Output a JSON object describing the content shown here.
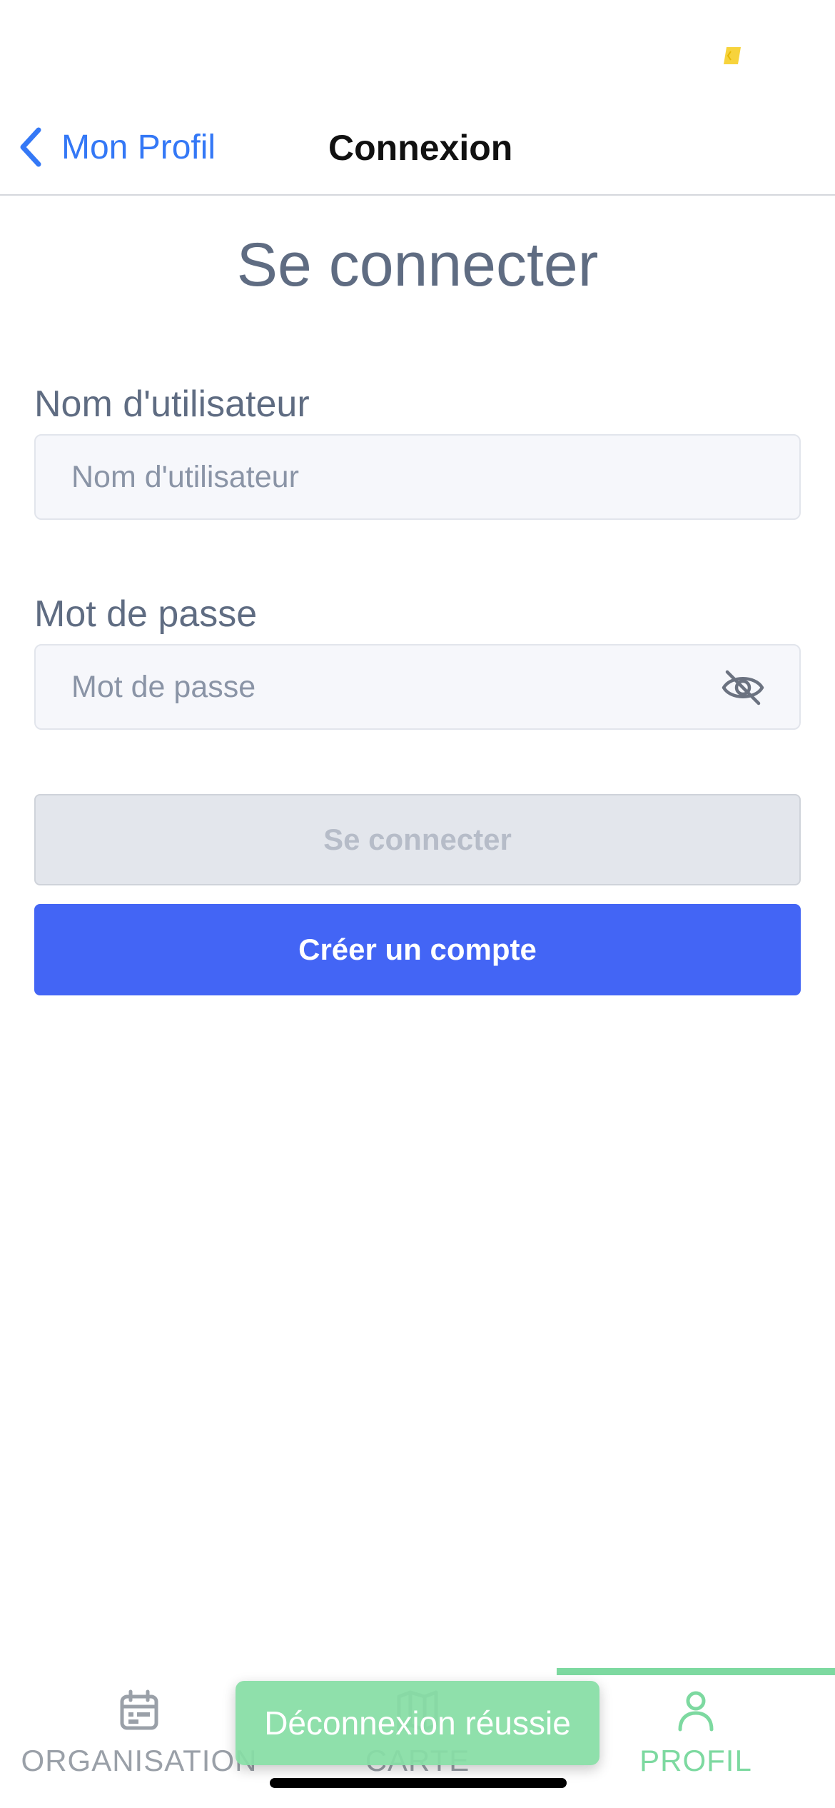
{
  "status_bar": {
    "indicator_color": "#f7d33c"
  },
  "header": {
    "back_label": "Mon Profil",
    "title": "Connexion"
  },
  "page": {
    "heading": "Se connecter"
  },
  "form": {
    "username": {
      "label": "Nom d'utilisateur",
      "placeholder": "Nom d'utilisateur",
      "value": ""
    },
    "password": {
      "label": "Mot de passe",
      "placeholder": "Mot de passe",
      "value": "",
      "visibility_icon": "eye-off-icon"
    },
    "login_button": {
      "label": "Se connecter",
      "state": "disabled"
    },
    "create_button": {
      "label": "Créer un compte"
    }
  },
  "tab_bar": {
    "tabs": [
      {
        "label": "ORGANISATION",
        "icon": "calendar-icon",
        "active": false
      },
      {
        "label": "CARTE",
        "icon": "map-icon",
        "active": false
      },
      {
        "label": "PROFIL",
        "icon": "person-icon",
        "active": true
      }
    ]
  },
  "toast": {
    "message": "Déconnexion réussie"
  },
  "colors": {
    "link": "#3478f6",
    "primary_button": "#4365f5",
    "disabled_button": "#e3e6ec",
    "active_tab": "#7dd9a0",
    "toast": "#86dea5",
    "heading_text": "#5f6c82"
  }
}
